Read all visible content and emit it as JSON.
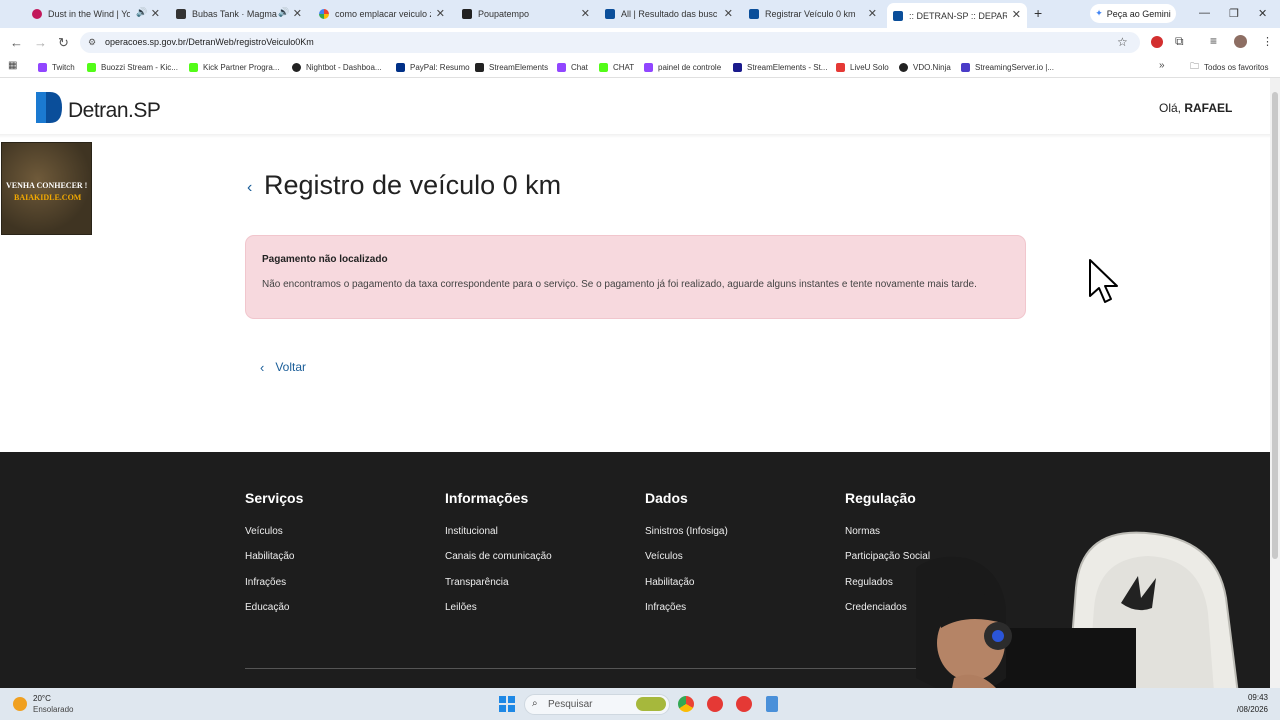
{
  "browser": {
    "tabs": [
      {
        "title": "Dust in the Wind | You",
        "color": "#c2185b"
      },
      {
        "title": "Bubas Tank · Magma C",
        "color": "#333333"
      },
      {
        "title": "como emplacar veiculo zero",
        "color": "#4285f4"
      },
      {
        "title": "Poupatempo",
        "color": "#222222"
      },
      {
        "title": "All | Resultado das buscas",
        "color": "#0a4e9a"
      },
      {
        "title": "Registrar Veículo 0 km",
        "color": "#0a4e9a"
      },
      {
        "title": ":: DETRAN-SP :: DEPARTAM",
        "color": "#0a4e9a"
      }
    ],
    "new_tab": "+",
    "gemini_label": "Peça ao Gemini",
    "url": "operacoes.sp.gov.br/DetranWeb/registroVeiculo0Km",
    "bookmarks": [
      {
        "label": "Twitch",
        "color": "#9146ff"
      },
      {
        "label": "Buozzi Stream - Kic...",
        "color": "#53fc18"
      },
      {
        "label": "Kick Partner Progra...",
        "color": "#53fc18"
      },
      {
        "label": "Nightbot - Dashboa...",
        "color": "#222222"
      },
      {
        "label": "PayPal: Resumo",
        "color": "#003087"
      },
      {
        "label": "StreamElements",
        "color": "#222222"
      },
      {
        "label": "Chat",
        "color": "#9146ff"
      },
      {
        "label": "CHAT",
        "color": "#53fc18"
      },
      {
        "label": "painel de controle",
        "color": "#9146ff"
      },
      {
        "label": "StreamElements - St...",
        "color": "#1a1a8c"
      },
      {
        "label": "LiveU Solo",
        "color": "#e53935"
      },
      {
        "label": "VDO.Ninja",
        "color": "#222222"
      },
      {
        "label": "StreamingServer.io |...",
        "color": "#4a3cc8"
      }
    ],
    "all_bookmarks": "Todos os favoritos"
  },
  "header": {
    "logo_text": "Detran.SP",
    "greeting_prefix": "Olá, ",
    "user_name": "RAFAEL"
  },
  "ad": {
    "line1": "VENHA CONHECER !",
    "line2": "BAIAKIDLE.COM"
  },
  "main": {
    "title": "Registro de veículo 0 km",
    "alert_title": "Pagamento não localizado",
    "alert_message": "Não encontramos o pagamento da taxa correspondente para o serviço. Se o pagamento já foi realizado, aguarde alguns instantes e tente novamente mais tarde.",
    "back_label": "Voltar"
  },
  "footer": {
    "columns": [
      {
        "title": "Serviços",
        "links": [
          "Veículos",
          "Habilitação",
          "Infrações",
          "Educação"
        ]
      },
      {
        "title": "Informações",
        "links": [
          "Institucional",
          "Canais de comunicação",
          "Transparência",
          "Leilões"
        ]
      },
      {
        "title": "Dados",
        "links": [
          "Sinistros (Infosiga)",
          "Veículos",
          "Habilitação",
          "Infrações"
        ]
      },
      {
        "title": "Regulação",
        "links": [
          "Normas",
          "Participação Social",
          "Regulados",
          "Credenciados"
        ]
      }
    ]
  },
  "taskbar": {
    "temperature": "20°C",
    "weather": "Ensolarado",
    "search_placeholder": "Pesquisar",
    "time": "09:43",
    "date": "/08/2026"
  },
  "colors": {
    "brand_blue": "#1b5e99",
    "alert_bg": "#f7d9de",
    "footer_bg": "#1d1d1d"
  }
}
